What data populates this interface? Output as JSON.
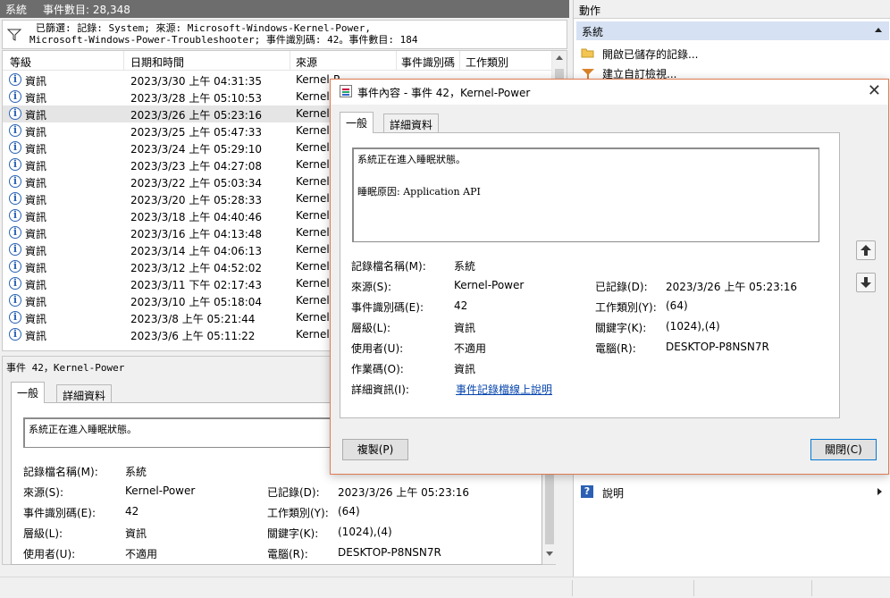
{
  "header": {
    "title": "系統",
    "count_label": "事件數目: 28,348"
  },
  "filter": {
    "line1": "已篩選: 記錄: System; 來源: Microsoft-Windows-Kernel-Power,",
    "line2": "Microsoft-Windows-Power-Troubleshooter; 事件識別碼: 42。事件數目: 184"
  },
  "list": {
    "columns": [
      "等級",
      "日期和時間",
      "來源",
      "事件識別碼",
      "工作類別"
    ],
    "rows": [
      {
        "level": "資訊",
        "datetime": "2023/3/30 上午 04:31:35",
        "source": "Kernel-P"
      },
      {
        "level": "資訊",
        "datetime": "2023/3/28 上午 05:10:53",
        "source": "Kernel-"
      },
      {
        "level": "資訊",
        "datetime": "2023/3/26 上午 05:23:16",
        "source": "Kernel-"
      },
      {
        "level": "資訊",
        "datetime": "2023/3/25 上午 05:47:33",
        "source": "Kernel-"
      },
      {
        "level": "資訊",
        "datetime": "2023/3/24 上午 05:29:10",
        "source": "Kernel-"
      },
      {
        "level": "資訊",
        "datetime": "2023/3/23 上午 04:27:08",
        "source": "Kernel-"
      },
      {
        "level": "資訊",
        "datetime": "2023/3/22 上午 05:03:34",
        "source": "Kernel-"
      },
      {
        "level": "資訊",
        "datetime": "2023/3/20 上午 05:28:33",
        "source": "Kernel-"
      },
      {
        "level": "資訊",
        "datetime": "2023/3/18 上午 04:40:46",
        "source": "Kernel-"
      },
      {
        "level": "資訊",
        "datetime": "2023/3/16 上午 04:13:48",
        "source": "Kernel-"
      },
      {
        "level": "資訊",
        "datetime": "2023/3/14 上午 04:06:13",
        "source": "Kernel-"
      },
      {
        "level": "資訊",
        "datetime": "2023/3/12 上午 04:52:02",
        "source": "Kernel-"
      },
      {
        "level": "資訊",
        "datetime": "2023/3/11 下午 02:17:43",
        "source": "Kernel-"
      },
      {
        "level": "資訊",
        "datetime": "2023/3/10 上午 05:18:04",
        "source": "Kernel-"
      },
      {
        "level": "資訊",
        "datetime": "2023/3/8 上午 05:21:44",
        "source": "Kernel-"
      },
      {
        "level": "資訊",
        "datetime": "2023/3/6 上午 05:11:22",
        "source": "Kernel-"
      }
    ],
    "selected_index": 2
  },
  "detail": {
    "title": "事件 42，Kernel-Power",
    "tabs": [
      "一般",
      "詳細資料"
    ],
    "message": "系統正在進入睡眠狀態。",
    "fields": {
      "log_name_label": "記錄檔名稱(M):",
      "log_name": "系統",
      "source_label": "來源(S):",
      "source": "Kernel-Power",
      "logged_label": "已記錄(D):",
      "logged": "2023/3/26 上午 05:23:16",
      "event_id_label": "事件識別碼(E):",
      "event_id": "42",
      "task_label": "工作類別(Y):",
      "task": "(64)",
      "level_label": "層級(L):",
      "level": "資訊",
      "keywords_label": "關鍵字(K):",
      "keywords": "(1024),(4)",
      "user_label": "使用者(U):",
      "user": "不適用",
      "computer_label": "電腦(R):",
      "computer": "DESKTOP-P8NSN7R"
    }
  },
  "actions": {
    "header": "動作",
    "section": "系統",
    "items": [
      "開啟已儲存的記錄...",
      "建立自訂檢視...",
      "說明"
    ]
  },
  "dialog": {
    "title": "事件內容 - 事件 42，Kernel-Power",
    "tabs": [
      "一般",
      "詳細資料"
    ],
    "message_line1": "系統正在進入睡眠狀態。",
    "message_line2": "睡眠原因: Application API",
    "opcode_label": "作業碼(O):",
    "opcode": "資訊",
    "more_info_label": "詳細資訊(I):",
    "more_info_link": "事件記錄檔線上說明",
    "copy_button": "複製(P)",
    "close_button": "關閉(C)"
  }
}
